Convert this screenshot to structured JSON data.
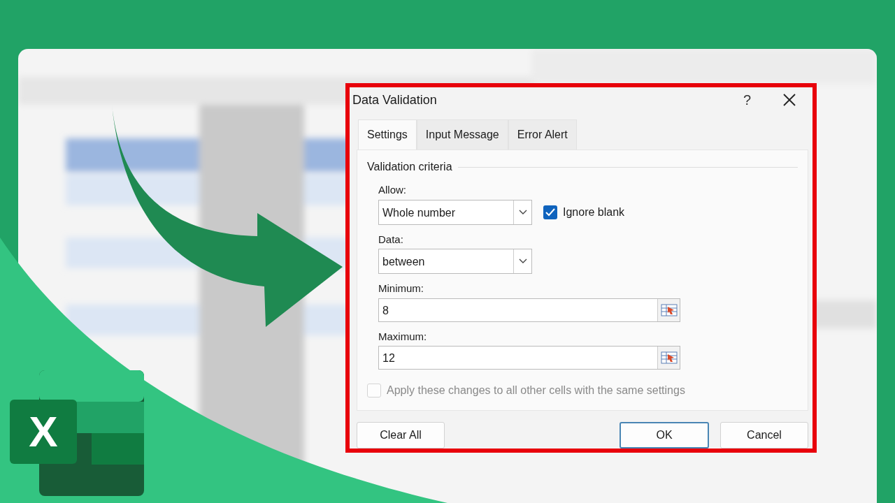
{
  "dialog": {
    "title": "Data Validation",
    "help": "?",
    "tabs": [
      {
        "label": "Settings",
        "selected": true
      },
      {
        "label": "Input Message",
        "selected": false
      },
      {
        "label": "Error Alert",
        "selected": false
      }
    ],
    "section": "Validation criteria",
    "allow": {
      "label": "Allow:",
      "value": "Whole number"
    },
    "ignore_blank": {
      "label": "Ignore blank",
      "checked": true
    },
    "data": {
      "label": "Data:",
      "value": "between"
    },
    "minimum": {
      "label": "Minimum:",
      "value": "8"
    },
    "maximum": {
      "label": "Maximum:",
      "value": "12"
    },
    "apply_all": {
      "label": "Apply these changes to all other cells with the same settings",
      "checked": false,
      "disabled": true
    },
    "buttons": [
      {
        "label": "Clear All",
        "default": false
      },
      {
        "label": "OK",
        "default": true
      },
      {
        "label": "Cancel",
        "default": false
      }
    ]
  },
  "logo": {
    "letter": "X"
  }
}
